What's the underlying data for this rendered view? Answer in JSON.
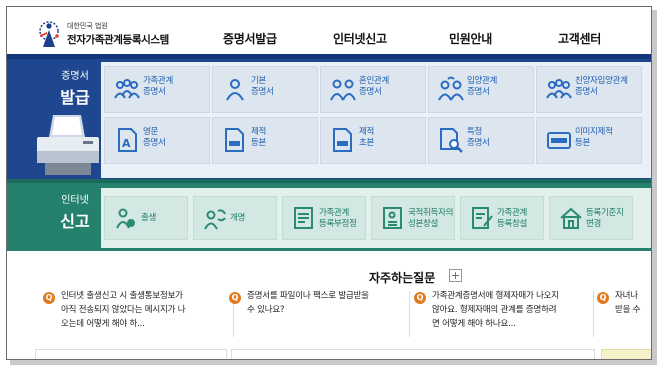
{
  "header": {
    "logo_sub": "대한민국 법원",
    "logo_title": "전자가족관계등록시스템",
    "nav": [
      "증명서발급",
      "인터넷신고",
      "민원안내",
      "고객센터"
    ]
  },
  "issue_section": {
    "label_1": "증명서",
    "label_2": "발급",
    "tiles": [
      {
        "line1": "가족관계",
        "line2": "증명서",
        "icon": "family-icon"
      },
      {
        "line1": "기본",
        "line2": "증명서",
        "icon": "person-icon"
      },
      {
        "line1": "혼인관계",
        "line2": "증명서",
        "icon": "couple-icon"
      },
      {
        "line1": "입양관계",
        "line2": "증명서",
        "icon": "adoption-icon"
      },
      {
        "line1": "친양자입양관계",
        "line2": "증명서",
        "icon": "family-icon"
      },
      {
        "line1": "영문",
        "line2": "증명서",
        "icon": "english-doc-icon"
      },
      {
        "line1": "제적",
        "line2": "등본",
        "icon": "removed-doc-icon"
      },
      {
        "line1": "제적",
        "line2": "초본",
        "icon": "removed-doc-icon"
      },
      {
        "line1": "특정",
        "line2": "증명서",
        "icon": "search-doc-icon"
      },
      {
        "line1": "이미지제적",
        "line2": "등본",
        "icon": "image-doc-icon"
      }
    ]
  },
  "report_section": {
    "label_1": "인터넷",
    "label_2": "신고",
    "tiles": [
      {
        "line1": "출생",
        "line2": "",
        "icon": "baby-icon"
      },
      {
        "line1": "개명",
        "line2": "",
        "icon": "rename-icon"
      },
      {
        "line1": "가족관계",
        "line2": "등록부정정",
        "icon": "form-list-icon"
      },
      {
        "line1": "국적취득자의",
        "line2": "성본창설",
        "icon": "id-card-icon"
      },
      {
        "line1": "가족관계",
        "line2": "등록창설",
        "icon": "form-edit-icon"
      },
      {
        "line1": "등록기준지",
        "line2": "변경",
        "icon": "house-icon"
      }
    ]
  },
  "faq": {
    "title": "자주하는질문",
    "plus": "+",
    "marker": "Q",
    "items": [
      {
        "l1": "인터넷 출생신고 시 출생통보정보가",
        "l2": "아직 전송되지 않았다는 메시지가 나",
        "l3": "오는데 어떻게 해야 하..."
      },
      {
        "l1": "증명서를 파일이나 팩스로 발급받을",
        "l2": "수 있나요?",
        "l3": ""
      },
      {
        "l1": "가족관계증명서에 형제자매가 나오지",
        "l2": "않아요. 형제자매의 관계를 증명하려",
        "l3": "면 어떻게 해야 하나요..."
      },
      {
        "l1": "자녀나 ",
        "l2": "받을 수",
        "l3": ""
      }
    ]
  },
  "colors": {
    "issue_band": "#1f478f",
    "report_band": "#26806e",
    "faq_marker": "#e07a1c",
    "tile_text_blue": "#1f5fb0",
    "tile_text_green": "#1c7a68"
  }
}
